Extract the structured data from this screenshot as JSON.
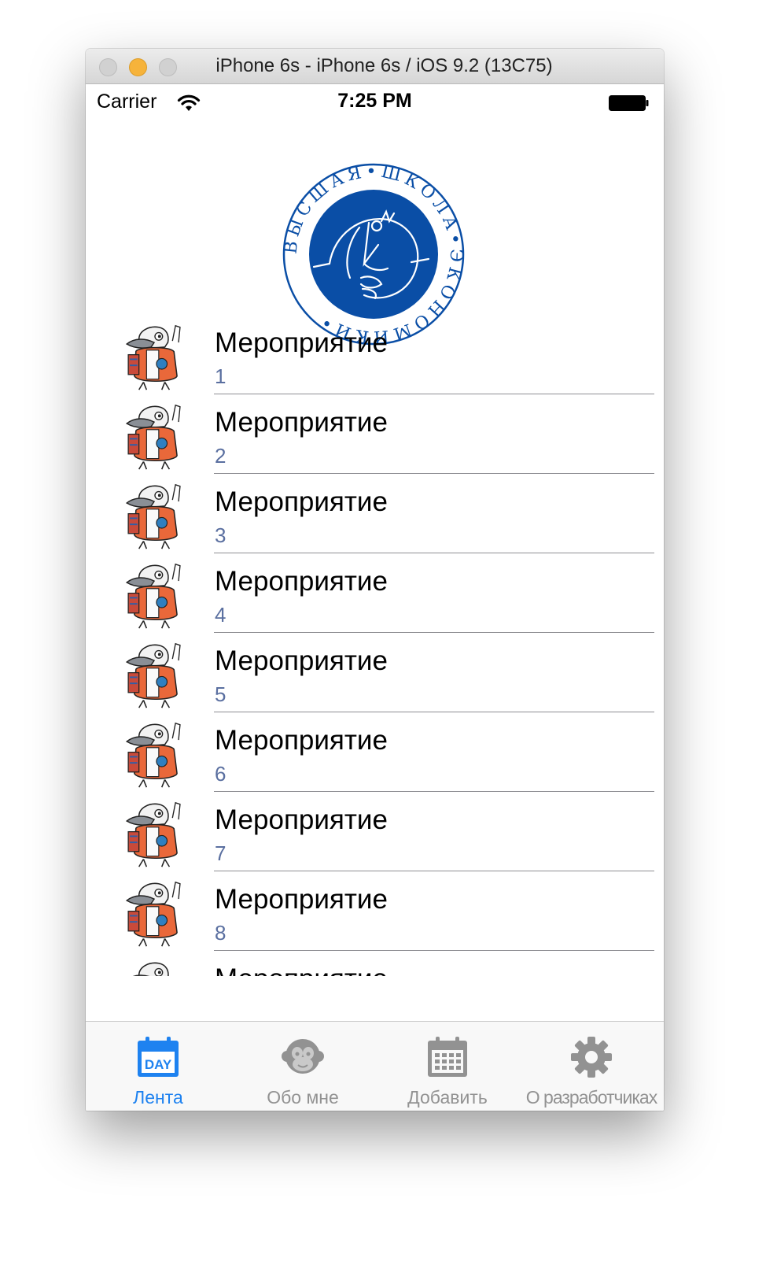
{
  "window": {
    "title": "iPhone 6s - iPhone 6s / iOS 9.2 (13C75)"
  },
  "status_bar": {
    "carrier": "Carrier",
    "time": "7:25 PM"
  },
  "logo": {
    "ring_text": "ВЫСШАЯ•ШКОЛА•ЭКОНОМИКИ•",
    "colors": {
      "brand": "#0a4ea6"
    }
  },
  "events": [
    {
      "title": "Мероприятие",
      "subtitle": "1"
    },
    {
      "title": "Мероприятие",
      "subtitle": "2"
    },
    {
      "title": "Мероприятие",
      "subtitle": "3"
    },
    {
      "title": "Мероприятие",
      "subtitle": "4"
    },
    {
      "title": "Мероприятие",
      "subtitle": "5"
    },
    {
      "title": "Мероприятие",
      "subtitle": "6"
    },
    {
      "title": "Мероприятие",
      "subtitle": "7"
    },
    {
      "title": "Мероприятие",
      "subtitle": "8"
    },
    {
      "title": "Мероприятие",
      "subtitle": ""
    }
  ],
  "tab_bar": {
    "tabs": [
      {
        "label": "Лента",
        "icon": "calendar-day-icon",
        "active": true
      },
      {
        "label": "Обо мне",
        "icon": "monkey-icon",
        "active": false
      },
      {
        "label": "Добавить",
        "icon": "calendar-grid-icon",
        "active": false
      },
      {
        "label": "О разработчиках",
        "icon": "gear-icon",
        "active": false
      }
    ],
    "day_badge": "DAY",
    "colors": {
      "active": "#1e82f0",
      "inactive": "#929292"
    }
  }
}
